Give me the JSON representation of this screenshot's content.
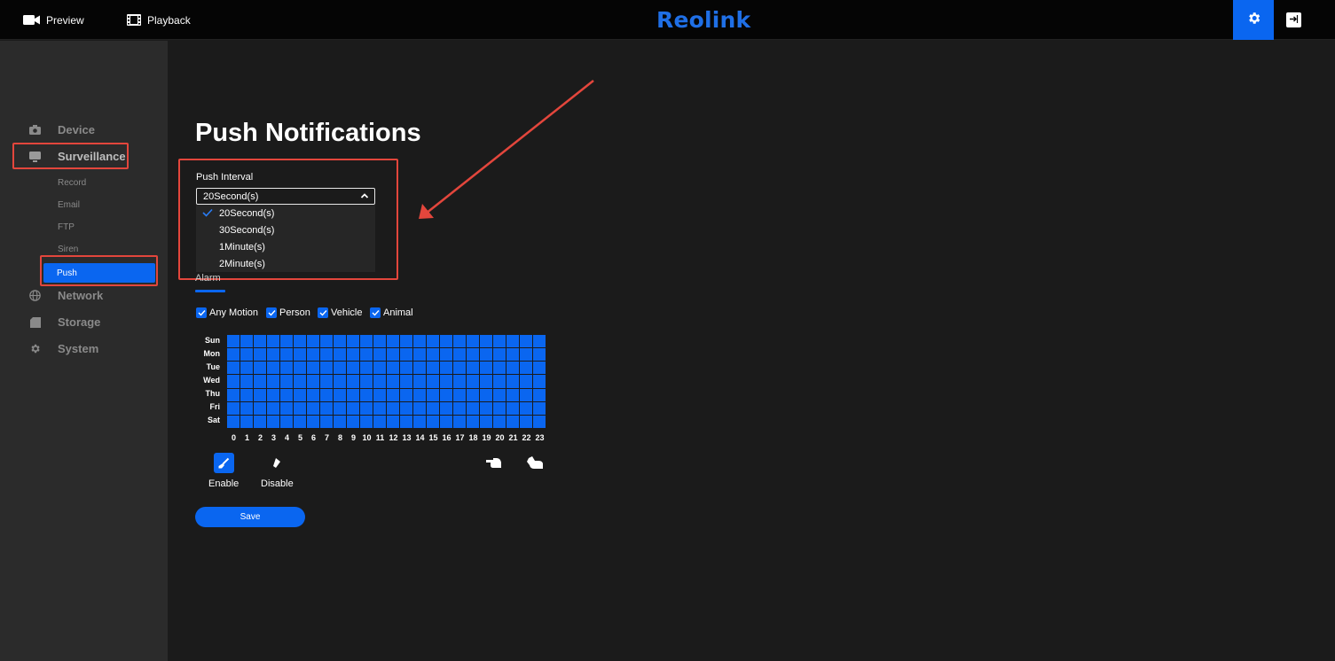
{
  "topbar": {
    "preview_label": "Preview",
    "playback_label": "Playback",
    "logo": "Reolink"
  },
  "sidebar": {
    "items": [
      {
        "label": "Device"
      },
      {
        "label": "Surveillance"
      },
      {
        "label": "Network"
      },
      {
        "label": "Storage"
      },
      {
        "label": "System"
      }
    ],
    "surveillance_sub": [
      {
        "label": "Record"
      },
      {
        "label": "Email"
      },
      {
        "label": "FTP"
      },
      {
        "label": "Siren"
      },
      {
        "label": "Push"
      }
    ],
    "active_sub": "Push"
  },
  "main": {
    "title": "Push Notifications",
    "push_interval": {
      "label": "Push Interval",
      "value": "20Second(s)",
      "options": [
        "20Second(s)",
        "30Second(s)",
        "1Minute(s)",
        "2Minute(s)"
      ]
    },
    "tab": "Alarm",
    "checkboxes": [
      {
        "label": "Any Motion",
        "checked": true
      },
      {
        "label": "Person",
        "checked": true
      },
      {
        "label": "Vehicle",
        "checked": true
      },
      {
        "label": "Animal",
        "checked": true
      }
    ],
    "schedule": {
      "days": [
        "Sun",
        "Mon",
        "Tue",
        "Wed",
        "Thu",
        "Fri",
        "Sat"
      ],
      "hours": [
        "0",
        "1",
        "2",
        "3",
        "4",
        "5",
        "6",
        "7",
        "8",
        "9",
        "10",
        "11",
        "12",
        "13",
        "14",
        "15",
        "16",
        "17",
        "18",
        "19",
        "20",
        "21",
        "22",
        "23"
      ],
      "all_enabled": true
    },
    "tools": {
      "enable_label": "Enable",
      "disable_label": "Disable"
    },
    "save_label": "Save"
  },
  "colors": {
    "accent": "#0a66f0",
    "annotation": "#e3463c",
    "sidebar_bg": "#2b2b2b",
    "main_bg": "#1b1b1b"
  }
}
